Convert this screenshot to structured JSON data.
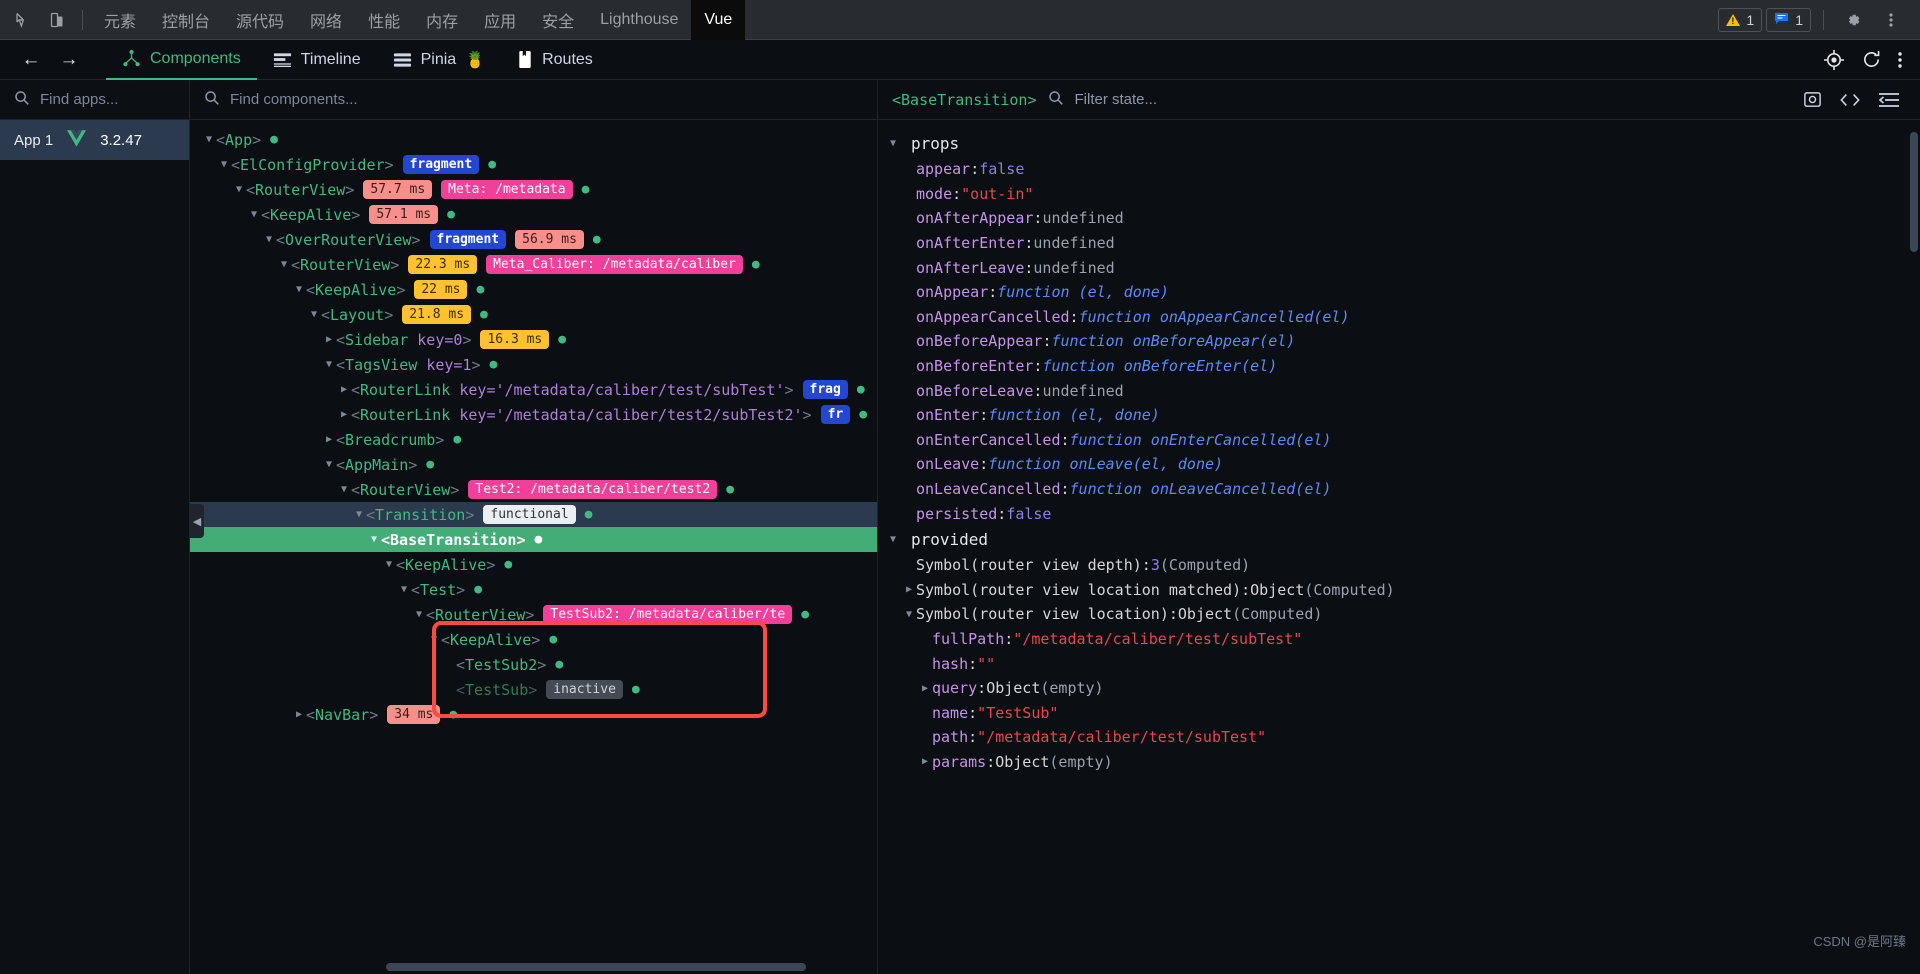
{
  "devtools_topbar": {
    "left_icons": [
      "inspect-icon",
      "device-toolbar-icon"
    ],
    "tabs": [
      {
        "label": "元素",
        "active": false
      },
      {
        "label": "控制台",
        "active": false
      },
      {
        "label": "源代码",
        "active": false
      },
      {
        "label": "网络",
        "active": false
      },
      {
        "label": "性能",
        "active": false
      },
      {
        "label": "内存",
        "active": false
      },
      {
        "label": "应用",
        "active": false
      },
      {
        "label": "安全",
        "active": false
      },
      {
        "label": "Lighthouse",
        "active": false
      },
      {
        "label": "Vue",
        "active": true
      }
    ],
    "warning_count": "1",
    "message_count": "1",
    "settings_label": "gear-icon",
    "more_label": "more-icon"
  },
  "vue_nav": {
    "back": "←",
    "forward": "→",
    "tabs": [
      {
        "label": "Components",
        "icon": "components-icon",
        "active": true
      },
      {
        "label": "Timeline",
        "icon": "timeline-icon",
        "active": false
      },
      {
        "label": "Pinia",
        "icon": "pinia-icon",
        "emoji": "🍍",
        "active": false
      },
      {
        "label": "Routes",
        "icon": "routes-icon",
        "active": false
      }
    ],
    "right_icons": [
      "select-component-icon",
      "refresh-icon",
      "more-icon"
    ]
  },
  "apps_pane": {
    "search_placeholder": "Find apps...",
    "selected_app": {
      "name": "App 1",
      "version": "3.2.47",
      "logo": "vue-logo-icon"
    }
  },
  "tree_pane": {
    "search_placeholder": "Find components...",
    "rows": [
      {
        "indent": 0,
        "arrow": "open",
        "name": "App",
        "attr": "",
        "badges": [],
        "state": "normal"
      },
      {
        "indent": 1,
        "arrow": "open",
        "name": "ElConfigProvider",
        "attr": "",
        "badges": [
          {
            "t": "fragment",
            "c": "frag"
          }
        ],
        "state": "normal"
      },
      {
        "indent": 2,
        "arrow": "open",
        "name": "RouterView",
        "attr": "",
        "badges": [
          {
            "t": "57.7 ms",
            "c": "red"
          },
          {
            "t": "Meta: /metadata",
            "c": "pink"
          }
        ],
        "state": "normal"
      },
      {
        "indent": 3,
        "arrow": "open",
        "name": "KeepAlive",
        "attr": "",
        "badges": [
          {
            "t": "57.1 ms",
            "c": "red"
          }
        ],
        "state": "normal"
      },
      {
        "indent": 4,
        "arrow": "open",
        "name": "OverRouterView",
        "attr": "",
        "badges": [
          {
            "t": "fragment",
            "c": "frag"
          },
          {
            "t": "56.9 ms",
            "c": "red"
          }
        ],
        "state": "normal"
      },
      {
        "indent": 5,
        "arrow": "open",
        "name": "RouterView",
        "attr": "",
        "badges": [
          {
            "t": "22.3 ms",
            "c": "amber"
          },
          {
            "t": "Meta_Caliber: /metadata/caliber",
            "c": "pink"
          }
        ],
        "state": "normal"
      },
      {
        "indent": 6,
        "arrow": "open",
        "name": "KeepAlive",
        "attr": "",
        "badges": [
          {
            "t": "22 ms",
            "c": "amber"
          }
        ],
        "state": "normal"
      },
      {
        "indent": 7,
        "arrow": "open",
        "name": "Layout",
        "attr": "",
        "badges": [
          {
            "t": "21.8 ms",
            "c": "amber"
          }
        ],
        "state": "normal"
      },
      {
        "indent": 8,
        "arrow": "closed",
        "name": "Sidebar",
        "attr": "key=0",
        "badges": [
          {
            "t": "16.3 ms",
            "c": "amber"
          }
        ],
        "state": "normal"
      },
      {
        "indent": 8,
        "arrow": "open",
        "name": "TagsView",
        "attr": "key=1",
        "badges": [],
        "state": "normal"
      },
      {
        "indent": 9,
        "arrow": "closed",
        "name": "RouterLink",
        "attr": "key='/metadata/caliber/test/subTest'",
        "badges": [
          {
            "t": "frag",
            "c": "frag"
          }
        ],
        "state": "normal"
      },
      {
        "indent": 9,
        "arrow": "closed",
        "name": "RouterLink",
        "attr": "key='/metadata/caliber/test2/subTest2'",
        "badges": [
          {
            "t": "fr",
            "c": "frag"
          }
        ],
        "state": "normal"
      },
      {
        "indent": 8,
        "arrow": "closed",
        "name": "Breadcrumb",
        "attr": "",
        "badges": [],
        "state": "normal"
      },
      {
        "indent": 8,
        "arrow": "open",
        "name": "AppMain",
        "attr": "",
        "badges": [],
        "state": "normal"
      },
      {
        "indent": 9,
        "arrow": "open",
        "name": "RouterView",
        "attr": "",
        "badges": [
          {
            "t": "Test2: /metadata/caliber/test2",
            "c": "pink"
          }
        ],
        "state": "normal"
      },
      {
        "indent": 10,
        "arrow": "open",
        "name": "Transition",
        "attr": "",
        "badges": [
          {
            "t": "functional",
            "c": "func"
          }
        ],
        "state": "hover"
      },
      {
        "indent": 11,
        "arrow": "open",
        "name": "BaseTransition",
        "attr": "",
        "badges": [],
        "state": "selected"
      },
      {
        "indent": 12,
        "arrow": "open",
        "name": "KeepAlive",
        "attr": "",
        "badges": [],
        "state": "normal"
      },
      {
        "indent": 13,
        "arrow": "open",
        "name": "Test",
        "attr": "",
        "badges": [],
        "state": "normal"
      },
      {
        "indent": 14,
        "arrow": "open",
        "name": "RouterView",
        "attr": "",
        "badges": [
          {
            "t": "TestSub2: /metadata/caliber/te",
            "c": "pink"
          }
        ],
        "state": "normal"
      },
      {
        "indent": 15,
        "arrow": "open",
        "name": "KeepAlive",
        "attr": "",
        "badges": [],
        "state": "normal"
      },
      {
        "indent": 16,
        "arrow": "none",
        "name": "TestSub2",
        "attr": "",
        "badges": [],
        "state": "normal"
      },
      {
        "indent": 16,
        "arrow": "none",
        "name": "TestSub",
        "attr": "",
        "badges": [
          {
            "t": "inactive",
            "c": "inactive"
          }
        ],
        "state": "dimmed"
      },
      {
        "indent": 6,
        "arrow": "closed",
        "name": "NavBar",
        "attr": "",
        "badges": [
          {
            "t": "34 ms",
            "c": "red"
          }
        ],
        "state": "normal"
      }
    ],
    "highlight_box_label": "red-annotation-box"
  },
  "detail_pane": {
    "component_name": "<BaseTransition>",
    "filter_placeholder": "Filter state...",
    "right_icons": [
      "open-in-editor-icon",
      "code-icon",
      "collapse-icon"
    ],
    "sections": [
      {
        "name": "props",
        "arrow": "open",
        "rows": [
          {
            "indent": 0,
            "arrow": "none",
            "key": "appear",
            "sep": ":",
            "value": "false",
            "vtype": "bool",
            "note": ""
          },
          {
            "indent": 0,
            "arrow": "none",
            "key": "mode",
            "sep": ":",
            "value": "\"out-in\"",
            "vtype": "str",
            "note": ""
          },
          {
            "indent": 0,
            "arrow": "none",
            "key": "onAfterAppear",
            "sep": ":",
            "value": "undefined",
            "vtype": "undef",
            "note": ""
          },
          {
            "indent": 0,
            "arrow": "none",
            "key": "onAfterEnter",
            "sep": ":",
            "value": "undefined",
            "vtype": "undef",
            "note": ""
          },
          {
            "indent": 0,
            "arrow": "none",
            "key": "onAfterLeave",
            "sep": ":",
            "value": "undefined",
            "vtype": "undef",
            "note": ""
          },
          {
            "indent": 0,
            "arrow": "none",
            "key": "onAppear",
            "sep": ":",
            "value": "function (el, done)",
            "vtype": "fn",
            "note": ""
          },
          {
            "indent": 0,
            "arrow": "none",
            "key": "onAppearCancelled",
            "sep": ":",
            "value": "function onAppearCancelled(el)",
            "vtype": "fn",
            "note": ""
          },
          {
            "indent": 0,
            "arrow": "none",
            "key": "onBeforeAppear",
            "sep": ":",
            "value": "function onBeforeAppear(el)",
            "vtype": "fn",
            "note": ""
          },
          {
            "indent": 0,
            "arrow": "none",
            "key": "onBeforeEnter",
            "sep": ":",
            "value": "function onBeforeEnter(el)",
            "vtype": "fn",
            "note": ""
          },
          {
            "indent": 0,
            "arrow": "none",
            "key": "onBeforeLeave",
            "sep": ":",
            "value": "undefined",
            "vtype": "undef",
            "note": ""
          },
          {
            "indent": 0,
            "arrow": "none",
            "key": "onEnter",
            "sep": ":",
            "value": "function (el, done)",
            "vtype": "fn",
            "note": ""
          },
          {
            "indent": 0,
            "arrow": "none",
            "key": "onEnterCancelled",
            "sep": ":",
            "value": "function onEnterCancelled(el)",
            "vtype": "fn",
            "note": ""
          },
          {
            "indent": 0,
            "arrow": "none",
            "key": "onLeave",
            "sep": ":",
            "value": "function onLeave(el, done)",
            "vtype": "fn",
            "note": ""
          },
          {
            "indent": 0,
            "arrow": "none",
            "key": "onLeaveCancelled",
            "sep": ":",
            "value": "function onLeaveCancelled(el)",
            "vtype": "fn",
            "note": ""
          },
          {
            "indent": 0,
            "arrow": "none",
            "key": "persisted",
            "sep": ":",
            "value": "false",
            "vtype": "bool",
            "note": ""
          }
        ]
      },
      {
        "name": "provided",
        "arrow": "open",
        "rows": [
          {
            "indent": 0,
            "arrow": "none",
            "key": "Symbol(router view depth)",
            "sep": ":",
            "value": "3",
            "vtype": "num",
            "note": "(Computed)"
          },
          {
            "indent": 0,
            "arrow": "closed",
            "key": "Symbol(router view location matched)",
            "sep": ":",
            "value": "Object",
            "vtype": "obj",
            "note": "(Computed)"
          },
          {
            "indent": 0,
            "arrow": "open",
            "key": "Symbol(router view location)",
            "sep": ":",
            "value": "Object",
            "vtype": "obj",
            "note": "(Computed)"
          },
          {
            "indent": 1,
            "arrow": "none",
            "key": "fullPath",
            "sep": ":",
            "value": "\"/metadata/caliber/test/subTest\"",
            "vtype": "str",
            "note": ""
          },
          {
            "indent": 1,
            "arrow": "none",
            "key": "hash",
            "sep": ":",
            "value": "\"\"",
            "vtype": "str",
            "note": ""
          },
          {
            "indent": 1,
            "arrow": "closed",
            "key": "query",
            "sep": ":",
            "value": "Object",
            "vtype": "obj",
            "note": "(empty)"
          },
          {
            "indent": 1,
            "arrow": "none",
            "key": "name",
            "sep": ":",
            "value": "\"TestSub\"",
            "vtype": "str",
            "note": ""
          },
          {
            "indent": 1,
            "arrow": "none",
            "key": "path",
            "sep": ":",
            "value": "\"/metadata/caliber/test/subTest\"",
            "vtype": "str",
            "note": ""
          },
          {
            "indent": 1,
            "arrow": "closed",
            "key": "params",
            "sep": ":",
            "value": "Object",
            "vtype": "obj",
            "note": "(empty)"
          }
        ]
      }
    ],
    "watermark": "CSDN @是阿臻"
  }
}
